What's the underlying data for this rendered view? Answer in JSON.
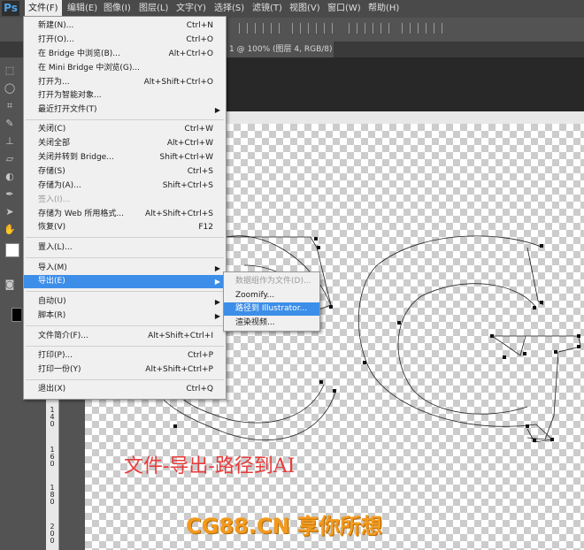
{
  "menubar": {
    "logo": "Ps",
    "items": [
      "文件(F)",
      "编辑(E)",
      "图像(I)",
      "图层(L)",
      "文字(Y)",
      "选择(S)",
      "滤镜(T)",
      "视图(V)",
      "窗口(W)",
      "帮助(H)"
    ]
  },
  "document_tab": {
    "title": "1 @ 100% (图层 4, RGB/8) *"
  },
  "file_menu": [
    {
      "label": "新建(N)...",
      "shortcut": "Ctrl+N"
    },
    {
      "label": "打开(O)...",
      "shortcut": "Ctrl+O"
    },
    {
      "label": "在 Bridge 中浏览(B)...",
      "shortcut": "Alt+Ctrl+O"
    },
    {
      "label": "在 Mini Bridge 中浏览(G)...",
      "shortcut": ""
    },
    {
      "label": "打开为...",
      "shortcut": "Alt+Shift+Ctrl+O"
    },
    {
      "label": "打开为智能对象...",
      "shortcut": ""
    },
    {
      "label": "最近打开文件(T)",
      "shortcut": "",
      "submenu": true
    },
    {
      "label": "关闭(C)",
      "shortcut": "Ctrl+W"
    },
    {
      "label": "关闭全部",
      "shortcut": "Alt+Ctrl+W"
    },
    {
      "label": "关闭并转到 Bridge...",
      "shortcut": "Shift+Ctrl+W"
    },
    {
      "label": "存储(S)",
      "shortcut": "Ctrl+S"
    },
    {
      "label": "存储为(A)...",
      "shortcut": "Shift+Ctrl+S"
    },
    {
      "label": "签入(I)...",
      "shortcut": "",
      "disabled": true
    },
    {
      "label": "存储为 Web 所用格式...",
      "shortcut": "Alt+Shift+Ctrl+S"
    },
    {
      "label": "恢复(V)",
      "shortcut": "F12"
    },
    {
      "label": "置入(L)...",
      "shortcut": ""
    },
    {
      "label": "导入(M)",
      "shortcut": "",
      "submenu": true
    },
    {
      "label": "导出(E)",
      "shortcut": "",
      "submenu": true,
      "highlighted": true
    },
    {
      "label": "自动(U)",
      "shortcut": "",
      "submenu": true
    },
    {
      "label": "脚本(R)",
      "shortcut": "",
      "submenu": true
    },
    {
      "label": "文件简介(F)...",
      "shortcut": "Alt+Shift+Ctrl+I"
    },
    {
      "label": "打印(P)...",
      "shortcut": "Ctrl+P"
    },
    {
      "label": "打印一份(Y)",
      "shortcut": "Alt+Shift+Ctrl+P"
    },
    {
      "label": "退出(X)",
      "shortcut": "Ctrl+Q"
    }
  ],
  "export_submenu": [
    {
      "label": "数据组作为文件(D)...",
      "disabled": true
    },
    {
      "label": "Zoomify..."
    },
    {
      "label": "路径到 Illustrator...",
      "highlighted": true
    },
    {
      "label": "渲染视频..."
    }
  ],
  "ruler_labels": [
    "1 4 0",
    "1 6 0",
    "1 8 0",
    "2 0 0"
  ],
  "annotation": "文件-导出-路径到AI",
  "watermark": "CG88.CN 享你所想",
  "colors": {
    "highlight": "#3d8ee8",
    "annotation": "#e83c3c",
    "watermark": "#f39a1e"
  }
}
